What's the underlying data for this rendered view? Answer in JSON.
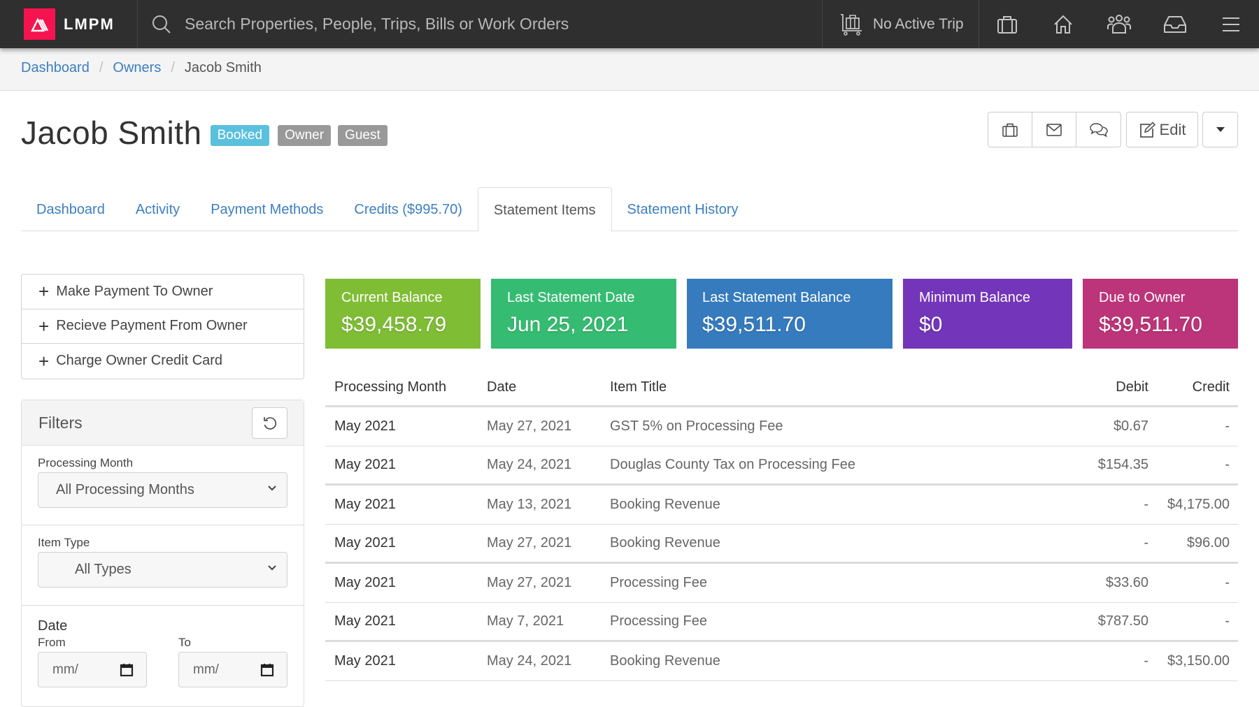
{
  "brand": {
    "name": "LMPM",
    "color": "#f5144f"
  },
  "nav": {
    "search_placeholder": "Search Properties, People, Trips, Bills or Work Orders",
    "trip_status": "No Active Trip",
    "icons": [
      "luggage-cart-icon",
      "briefcase-icon",
      "home-icon",
      "users-icon",
      "inbox-icon",
      "menu-icon"
    ]
  },
  "breadcrumb": [
    {
      "label": "Dashboard",
      "link": true
    },
    {
      "label": "Owners",
      "link": true
    },
    {
      "label": "Jacob Smith",
      "link": false
    }
  ],
  "header": {
    "title": "Jacob Smith",
    "badges": [
      {
        "label": "Booked",
        "color": "#5bc0de"
      },
      {
        "label": "Owner",
        "color": "#999999"
      },
      {
        "label": "Guest",
        "color": "#999999"
      }
    ],
    "edit_label": "Edit",
    "action_icons": [
      "briefcase-icon",
      "envelope-icon",
      "chat-icon"
    ]
  },
  "tabs": [
    {
      "label": "Dashboard",
      "active": false
    },
    {
      "label": "Activity",
      "active": false
    },
    {
      "label": "Payment Methods",
      "active": false
    },
    {
      "label": "Credits ($995.70)",
      "active": false
    },
    {
      "label": "Statement Items",
      "active": true
    },
    {
      "label": "Statement History",
      "active": false
    }
  ],
  "actions": [
    {
      "label": "Make Payment To Owner"
    },
    {
      "label": "Recieve Payment From Owner"
    },
    {
      "label": "Charge Owner Credit Card"
    }
  ],
  "filters": {
    "title": "Filters",
    "processing_month": {
      "label": "Processing Month",
      "value": "All Processing Months"
    },
    "item_type": {
      "label": "Item Type",
      "value": "All Types"
    },
    "date": {
      "label": "Date",
      "from_label": "From",
      "to_label": "To",
      "from_value": "mm/",
      "to_value": "mm/"
    }
  },
  "cards": [
    {
      "label": "Current Balance",
      "value": "$39,458.79",
      "color": "#7fbd35"
    },
    {
      "label": "Last Statement Date",
      "value": "Jun 25, 2021",
      "color": "#36bc72"
    },
    {
      "label": "Last Statement Balance",
      "value": "$39,511.70",
      "color": "#357bbd"
    },
    {
      "label": "Minimum Balance",
      "value": "$0",
      "color": "#7335b9"
    },
    {
      "label": "Due to Owner",
      "value": "$39,511.70",
      "color": "#bc3479"
    }
  ],
  "table": {
    "columns": [
      "Processing Month",
      "Date",
      "Item Title",
      "Debit",
      "Credit"
    ],
    "rows": [
      {
        "month": "May 2021",
        "date": "May 27, 2021",
        "title": "GST 5% on Processing Fee",
        "debit": "$0.67",
        "credit": "-"
      },
      {
        "month": "May 2021",
        "date": "May 24, 2021",
        "title": "Douglas County Tax on Processing Fee",
        "debit": "$154.35",
        "credit": "-"
      },
      {
        "month": "May 2021",
        "date": "May 13, 2021",
        "title": "Booking Revenue",
        "debit": "-",
        "credit": "$4,175.00"
      },
      {
        "month": "May 2021",
        "date": "May 27, 2021",
        "title": "Booking Revenue",
        "debit": "-",
        "credit": "$96.00"
      },
      {
        "month": "May 2021",
        "date": "May 27, 2021",
        "title": "Processing Fee",
        "debit": "$33.60",
        "credit": "-"
      },
      {
        "month": "May 2021",
        "date": "May 7, 2021",
        "title": "Processing Fee",
        "debit": "$787.50",
        "credit": "-"
      },
      {
        "month": "May 2021",
        "date": "May 24, 2021",
        "title": "Booking Revenue",
        "debit": "-",
        "credit": "$3,150.00"
      }
    ]
  }
}
